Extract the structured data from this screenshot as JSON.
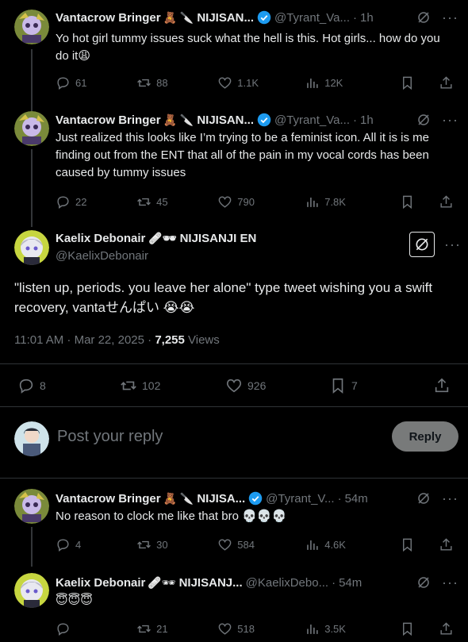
{
  "tweets": {
    "t1": {
      "name": "Vantacrow Bringer",
      "emoji": "🧸 🔪",
      "org": "NIJISAN...",
      "handle": "@Tyrant_Va...",
      "time": "1h",
      "text": "Yo hot girl tummy issues suck what the hell is this. Hot girls... how do you do it😩",
      "replies": "61",
      "retweets": "88",
      "likes": "1.1K",
      "views": "12K"
    },
    "t2": {
      "name": "Vantacrow Bringer",
      "emoji": "🧸 🔪",
      "org": "NIJISAN...",
      "handle": "@Tyrant_Va...",
      "time": "1h",
      "text": "Just realized this looks like I’m trying to be a feminist icon. All it is is me finding out from the ENT that all of the pain in my vocal cords has been caused by tummy issues",
      "replies": "22",
      "retweets": "45",
      "likes": "790",
      "views": "7.8K"
    },
    "main": {
      "name": "Kaelix Debonair",
      "emoji": "🩹🕶",
      "org": "NIJISANJI EN",
      "handle": "@KaelixDebonair",
      "text": "\"listen up, periods. you leave her alone\" type tweet wishing you a swift recovery, vantaせんぱい 😭😭",
      "timestamp": "11:01 AM · Mar 22, 2025 · ",
      "views_count": "7,255",
      "views_label": " Views",
      "replies": "8",
      "retweets": "102",
      "likes": "926",
      "bookmarks": "7"
    },
    "t3": {
      "name": "Vantacrow Bringer",
      "emoji": "🧸 🔪",
      "org": "NIJISA...",
      "handle": "@Tyrant_V...",
      "time": "54m",
      "text": "No reason to clock me like that bro 💀💀💀",
      "replies": "4",
      "retweets": "30",
      "likes": "584",
      "views": "4.6K"
    },
    "t4": {
      "name": "Kaelix Debonair",
      "emoji": "🩹🕶",
      "org": "NIJISANJ...",
      "handle": "@KaelixDebo...",
      "time": "54m",
      "text": "😇😇😇",
      "replies": "",
      "retweets": "21",
      "likes": "518",
      "views": "3.5K"
    }
  },
  "reply_box": {
    "placeholder": "Post your reply",
    "button_label": "Reply"
  },
  "colors": {
    "background": "#000000",
    "text": "#e7e9ea",
    "muted": "#71767b",
    "verified": "#1d9bf0",
    "divider": "#2f3336",
    "reply_button": "#787a7a"
  }
}
